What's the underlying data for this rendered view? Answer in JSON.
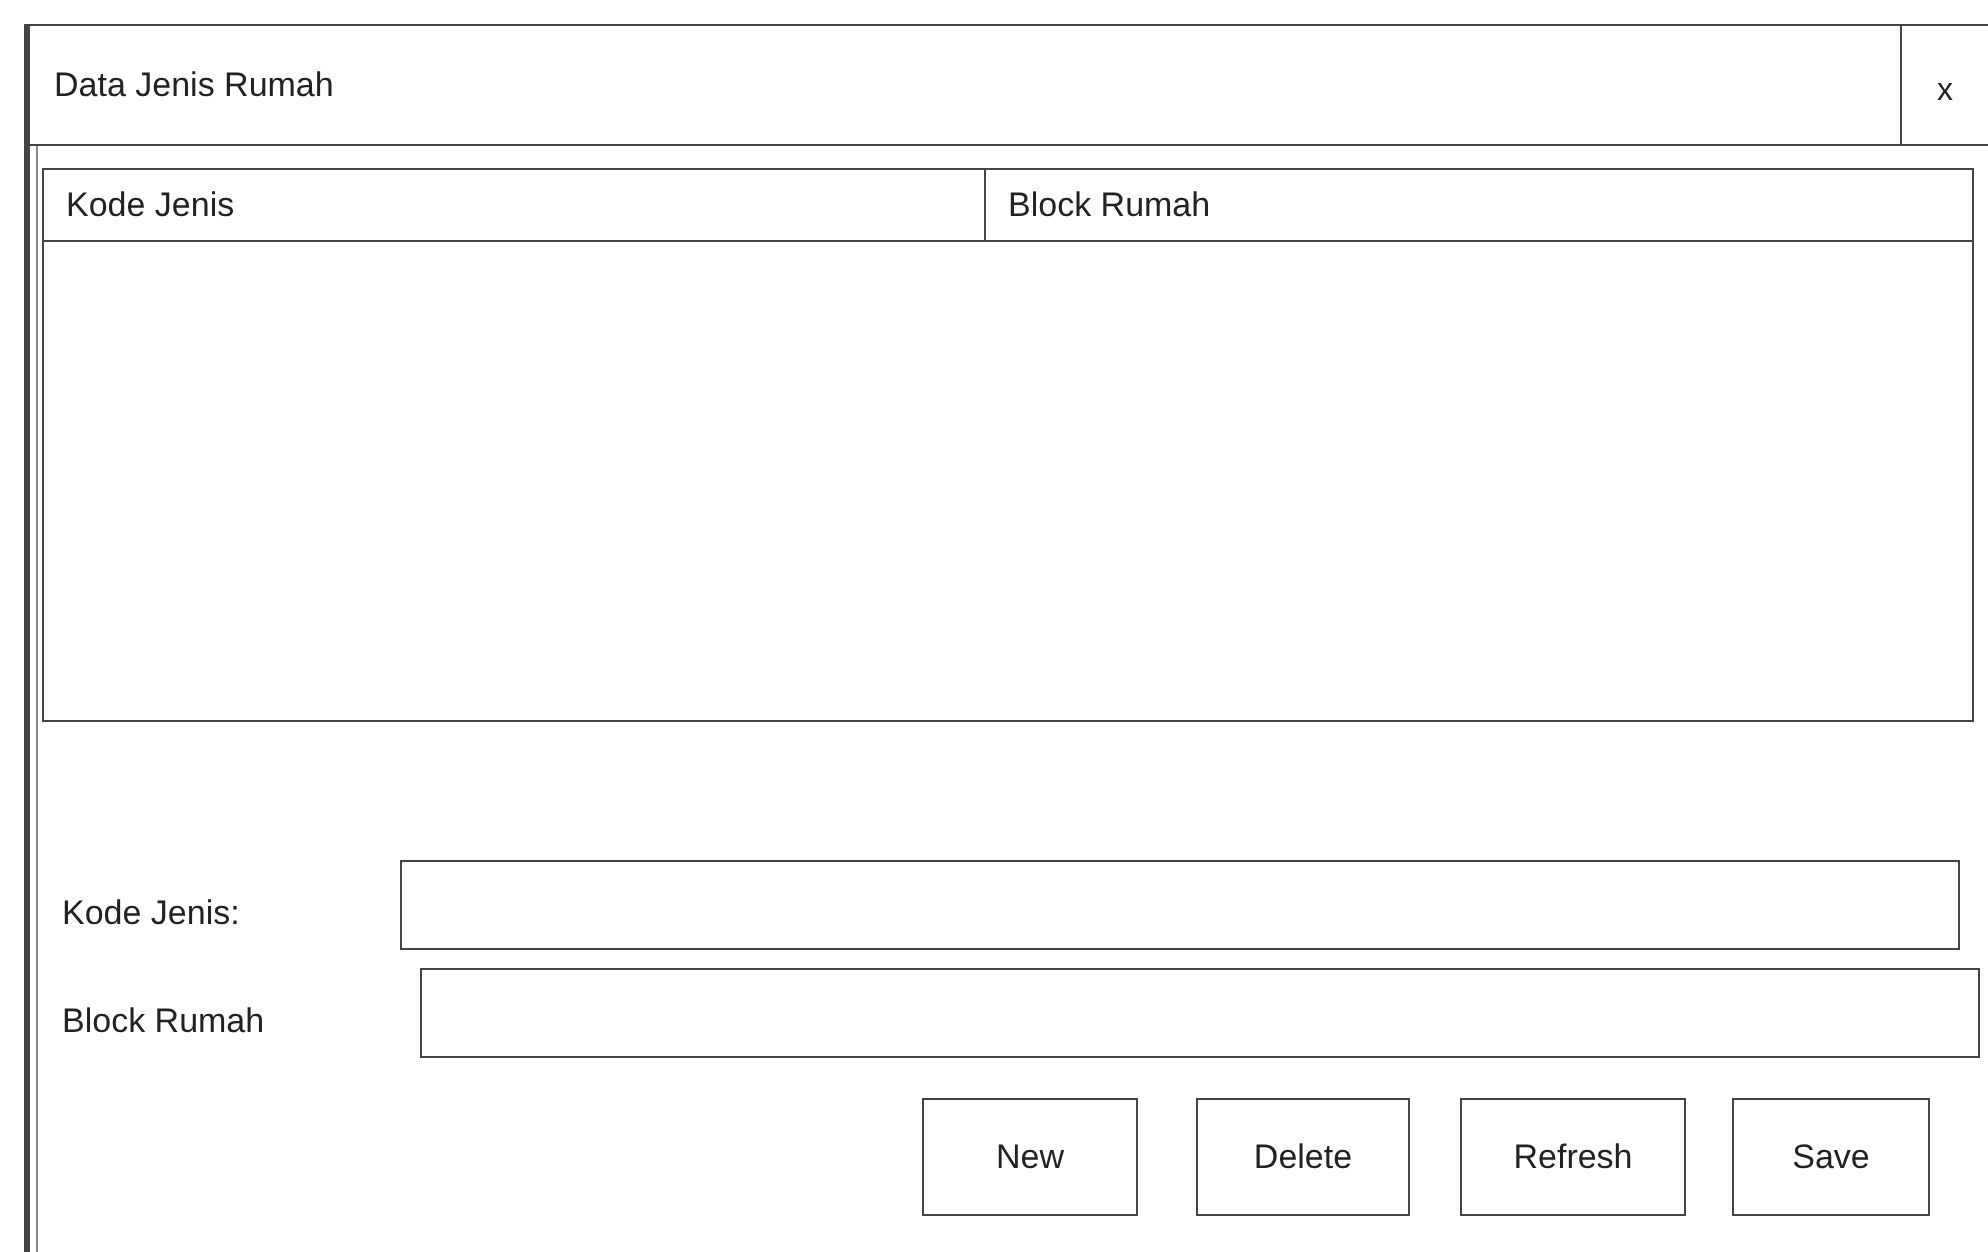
{
  "window": {
    "title": "Data Jenis Rumah",
    "close": "x"
  },
  "table": {
    "columns": [
      "Kode Jenis",
      "Block Rumah"
    ]
  },
  "form": [
    {
      "label": "Kode Jenis:"
    },
    {
      "label": "Block Rumah"
    }
  ],
  "buttons": [
    "New",
    "Delete",
    "Refresh",
    "Save"
  ]
}
